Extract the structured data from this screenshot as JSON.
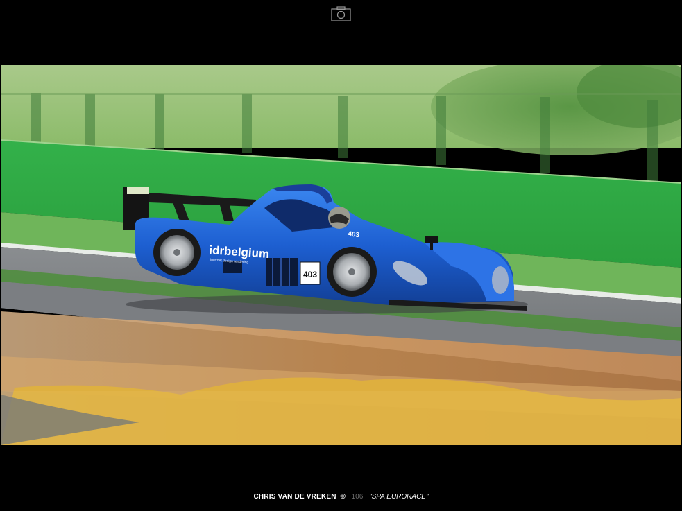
{
  "header": {
    "icon": "camera-icon"
  },
  "photo": {
    "subject": "car",
    "livery_text": "idrbelgium",
    "livery_subtext": "internet design rendering",
    "race_number": "403",
    "nose_number": "403",
    "colors": {
      "car": "#1d5fd1",
      "grass": "#4cae3d",
      "wall": "#3bb34a",
      "track": "#7a7d80",
      "kerb": "#e0b13c"
    }
  },
  "caption": {
    "author": "CHRIS VAN DE VREKEN",
    "copyright": "©",
    "page_number": "106",
    "title": "\"SPA EURORACE\""
  }
}
